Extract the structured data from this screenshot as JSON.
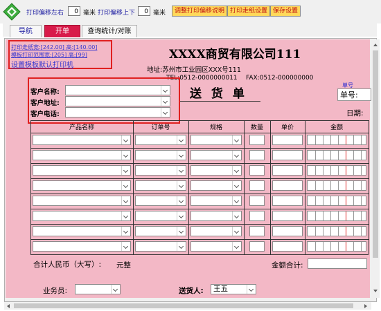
{
  "toolbar": {
    "offset_lr_label": "打印偏移左右",
    "offset_lr_value": "0",
    "unit_mm_1": "毫米",
    "offset_ud_label": "打印偏移上下",
    "offset_ud_value": "0",
    "unit_mm_2": "毫米",
    "btn_adjust": "调整打印偏移说明",
    "btn_paper": "打印走纸设置",
    "btn_save": "保存设置"
  },
  "tabs": [
    "导航",
    "开单",
    "查询统计/对账"
  ],
  "active_tab": "开单",
  "print_info": {
    "paper_size": "打印走纸宽:[242.00] 高:[140.00]",
    "template_range": "模板打印范围宽:[205] 高:[99]",
    "set_default_printer": "设置模板默认打印机"
  },
  "company": {
    "name": "XXXX商贸有限公司111",
    "address": "地址:苏州市工业园区XXX号111",
    "tel": "TEL:0512-0000000011",
    "fax": "FAX:0512-000000000"
  },
  "doc_title": "送 货 单",
  "doc_no_label_small": "单号",
  "doc_no_label": "单号:",
  "date_label": "日期:",
  "customer": {
    "name_label": "客户名称:",
    "address_label": "客户地址:",
    "phone_label": "客户电话:"
  },
  "table": {
    "headers": [
      "产品名称",
      "订单号",
      "规格",
      "数量",
      "单价",
      "金额"
    ],
    "row_count": 8
  },
  "totals": {
    "rmb_label": "合计人民币（大写）:",
    "rmb_value": "元整",
    "amount_label": "金额合计:"
  },
  "footer": {
    "salesman_label": "业务员:",
    "salesman_value": "",
    "deliverer_label": "送货人:",
    "deliverer_value": "王五"
  },
  "colors": {
    "sheet_bg": "#f3b8c6",
    "highlight_box": "#e02020",
    "button_bg": "#ffd95a",
    "active_tab_bg": "#d81b4a"
  }
}
